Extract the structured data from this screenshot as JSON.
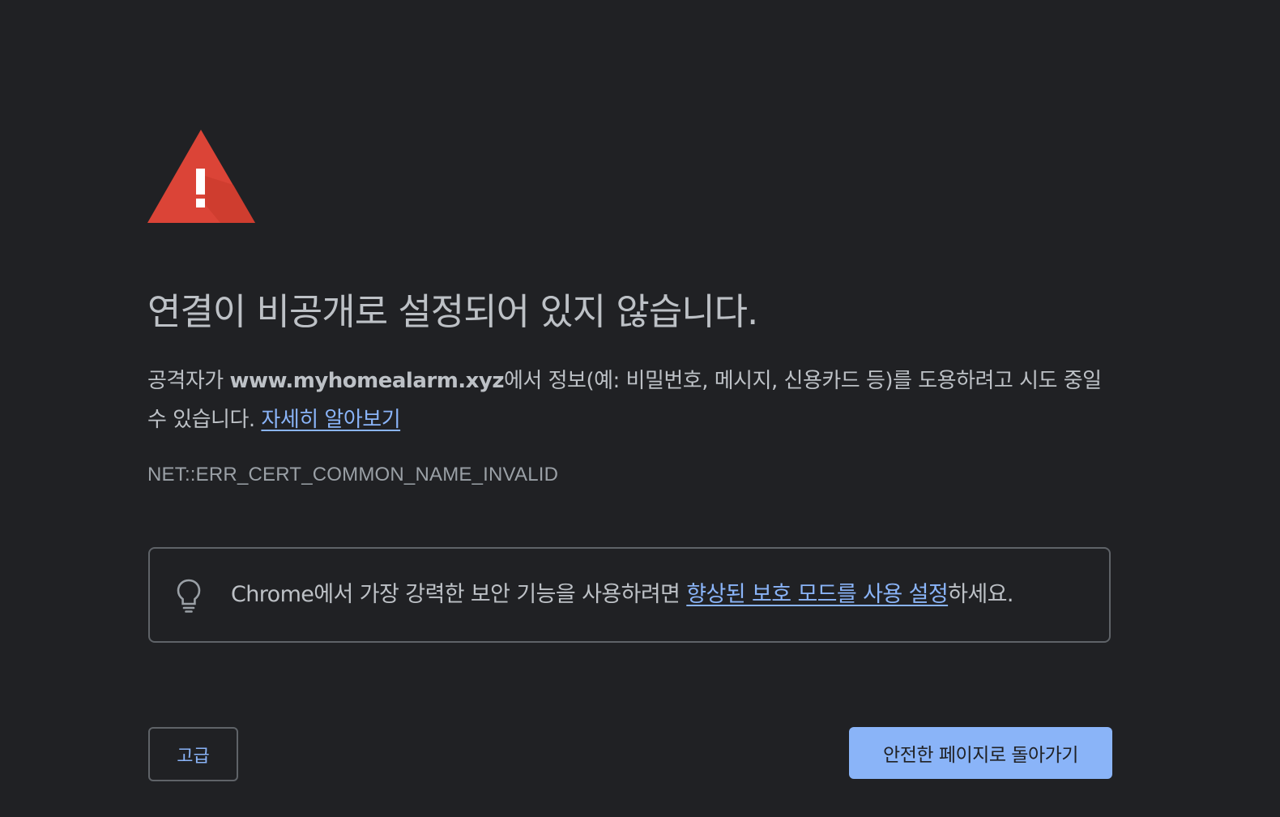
{
  "colors": {
    "background": "#202124",
    "text": "#bdc1c6",
    "muted": "#9aa0a6",
    "link": "#8ab4f8",
    "warning_red": "#db4437",
    "border": "#5f6368"
  },
  "warning": {
    "icon": "warning-triangle-icon"
  },
  "heading": "연결이 비공개로 설정되어 있지 않습니다.",
  "description": {
    "prefix": "공격자가 ",
    "domain": "www.myhomealarm.xyz",
    "suffix": "에서 정보(예: 비밀번호, 메시지, 신용카드 등)를 도용하려고 시도 중일 수 있습니다. ",
    "learn_more_link": "자세히 알아보기"
  },
  "error_code": "NET::ERR_CERT_COMMON_NAME_INVALID",
  "tip": {
    "icon": "lightbulb-icon",
    "prefix": "Chrome에서 가장 강력한 보안 기능을 사용하려면 ",
    "link": "향상된 보호 모드를 사용 설정",
    "suffix": "하세요."
  },
  "buttons": {
    "advanced": "고급",
    "back_to_safety": "안전한 페이지로 돌아가기"
  }
}
